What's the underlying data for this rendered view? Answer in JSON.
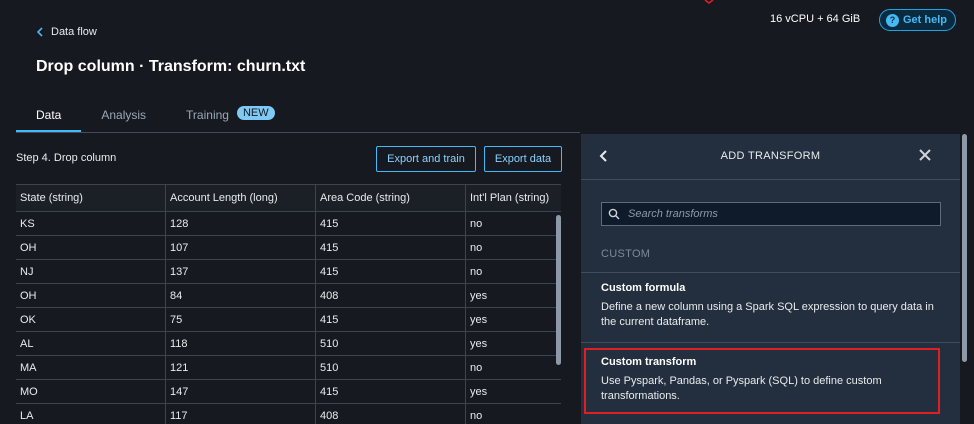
{
  "header": {
    "back_label": "Data flow",
    "title": "Drop column · Transform: churn.txt",
    "resource": "16 vCPU + 64 GiB",
    "help_label": "Get help",
    "help_icon": "question-circle-icon"
  },
  "tabs": [
    {
      "label": "Data",
      "active": true
    },
    {
      "label": "Analysis",
      "active": false
    },
    {
      "label": "Training",
      "active": false,
      "badge": "NEW"
    }
  ],
  "step": {
    "title": "Step 4. Drop column",
    "export_train_label": "Export and train",
    "export_data_label": "Export data"
  },
  "table": {
    "columns": [
      "State (string)",
      "Account Length (long)",
      "Area Code (string)",
      "Int'l Plan (string)"
    ],
    "rows": [
      [
        "KS",
        "128",
        "415",
        "no"
      ],
      [
        "OH",
        "107",
        "415",
        "no"
      ],
      [
        "NJ",
        "137",
        "415",
        "no"
      ],
      [
        "OH",
        "84",
        "408",
        "yes"
      ],
      [
        "OK",
        "75",
        "415",
        "yes"
      ],
      [
        "AL",
        "118",
        "510",
        "yes"
      ],
      [
        "MA",
        "121",
        "510",
        "no"
      ],
      [
        "MO",
        "147",
        "415",
        "yes"
      ],
      [
        "LA",
        "117",
        "408",
        "no"
      ]
    ]
  },
  "panel": {
    "title": "ADD TRANSFORM",
    "search_placeholder": "Search transforms",
    "section": "CUSTOM",
    "items": [
      {
        "title": "Custom formula",
        "desc": "Define a new column using a Spark SQL expression to query data in the current dataframe."
      },
      {
        "title": "Custom transform",
        "desc": "Use Pyspark, Pandas, or Pyspark (SQL) to define custom transformations.",
        "highlighted": true
      }
    ]
  },
  "colors": {
    "background": "#16191f",
    "panel": "#232f3e",
    "accent": "#44b9f5",
    "highlight": "#e02020"
  }
}
